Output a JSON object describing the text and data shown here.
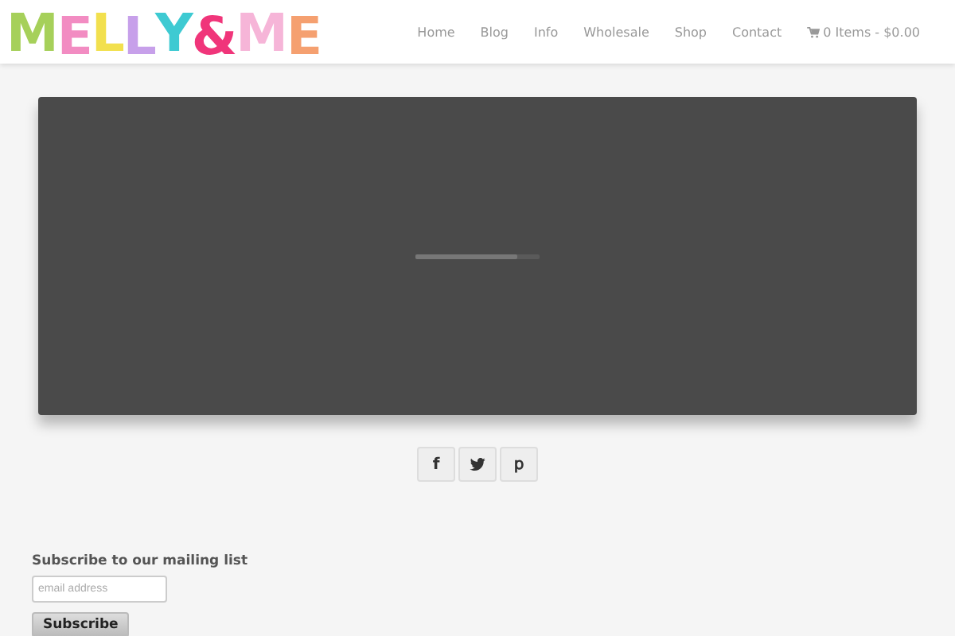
{
  "logo": {
    "letters": [
      {
        "char": "M",
        "color": "#a6d05a"
      },
      {
        "char": "E",
        "color": "#f28cc2"
      },
      {
        "char": "L",
        "color": "#f2e04e"
      },
      {
        "char": "L",
        "color": "#c7a0ea"
      },
      {
        "char": "Y",
        "color": "#3ecad2"
      },
      {
        "char": "&",
        "color": "#f0357a"
      },
      {
        "char": "M",
        "color": "#f6b5d8"
      },
      {
        "char": "E",
        "color": "#f5a070"
      }
    ]
  },
  "nav": [
    {
      "label": "Home"
    },
    {
      "label": "Blog"
    },
    {
      "label": "Info"
    },
    {
      "label": "Wholesale"
    },
    {
      "label": "Shop"
    },
    {
      "label": "Contact"
    }
  ],
  "cart": {
    "label": "0 Items - $0.00"
  },
  "video": {
    "loading": {
      "level": 0.82
    }
  },
  "share_buttons": [
    {
      "kind": "text",
      "label": "f"
    },
    {
      "kind": "bird"
    },
    {
      "kind": "text",
      "label": "𝗉"
    }
  ],
  "mailing_list": {
    "heading": "Subscribe to our mailing list",
    "email": {
      "placeholder": "email address"
    },
    "button": "Subscribe"
  }
}
